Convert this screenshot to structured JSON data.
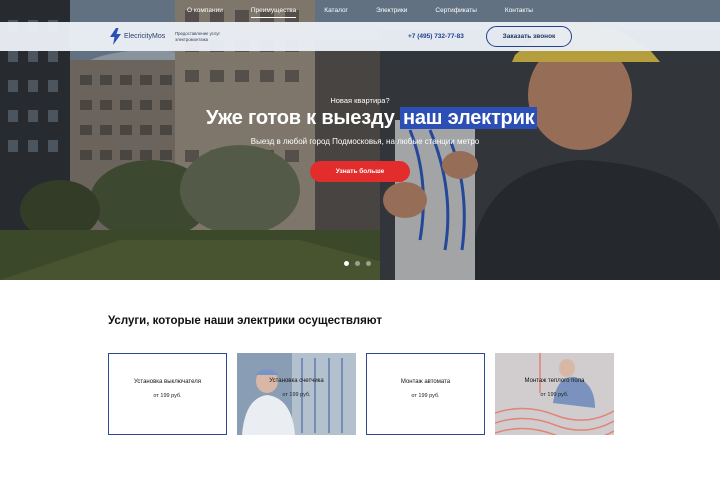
{
  "nav": {
    "items": [
      "О компании",
      "Преимущества",
      "Каталог",
      "Электрики",
      "Сертификаты",
      "Контакты"
    ],
    "active_index": 1
  },
  "header": {
    "logo_text": "ElecricityMos",
    "tagline": "Предоставление услуг электромонтажа",
    "phone": "+7 (495) 732-77-83",
    "callback_label": "Заказать звонок"
  },
  "hero": {
    "subtitle": "Новая квартира?",
    "title_prefix": "Уже готов к выезду",
    "title_highlight": "наш электрик",
    "description": "Выезд в любой город Подмосковья,  на любые станции метро",
    "cta_label": "Узнать больше",
    "slides_total": 3,
    "active_slide": 1
  },
  "services": {
    "title": "Услуги, которые наши электрики осуществляют",
    "cards": [
      {
        "title": "Установка выключателя",
        "price": "от 199 руб.",
        "has_photo": false
      },
      {
        "title": "Установка счетчика",
        "price": "от 199 руб.",
        "has_photo": true
      },
      {
        "title": "Монтаж автомата",
        "price": "от 199 руб.",
        "has_photo": false
      },
      {
        "title": "Монтаж теплого пола",
        "price": "от 199 руб.",
        "has_photo": true
      }
    ]
  },
  "colors": {
    "accent_blue": "#2c4fb5",
    "cta_red": "#e32d2d",
    "border_blue": "#2f4a8c"
  },
  "icons": {
    "logo": "lightning-bolt-icon"
  }
}
